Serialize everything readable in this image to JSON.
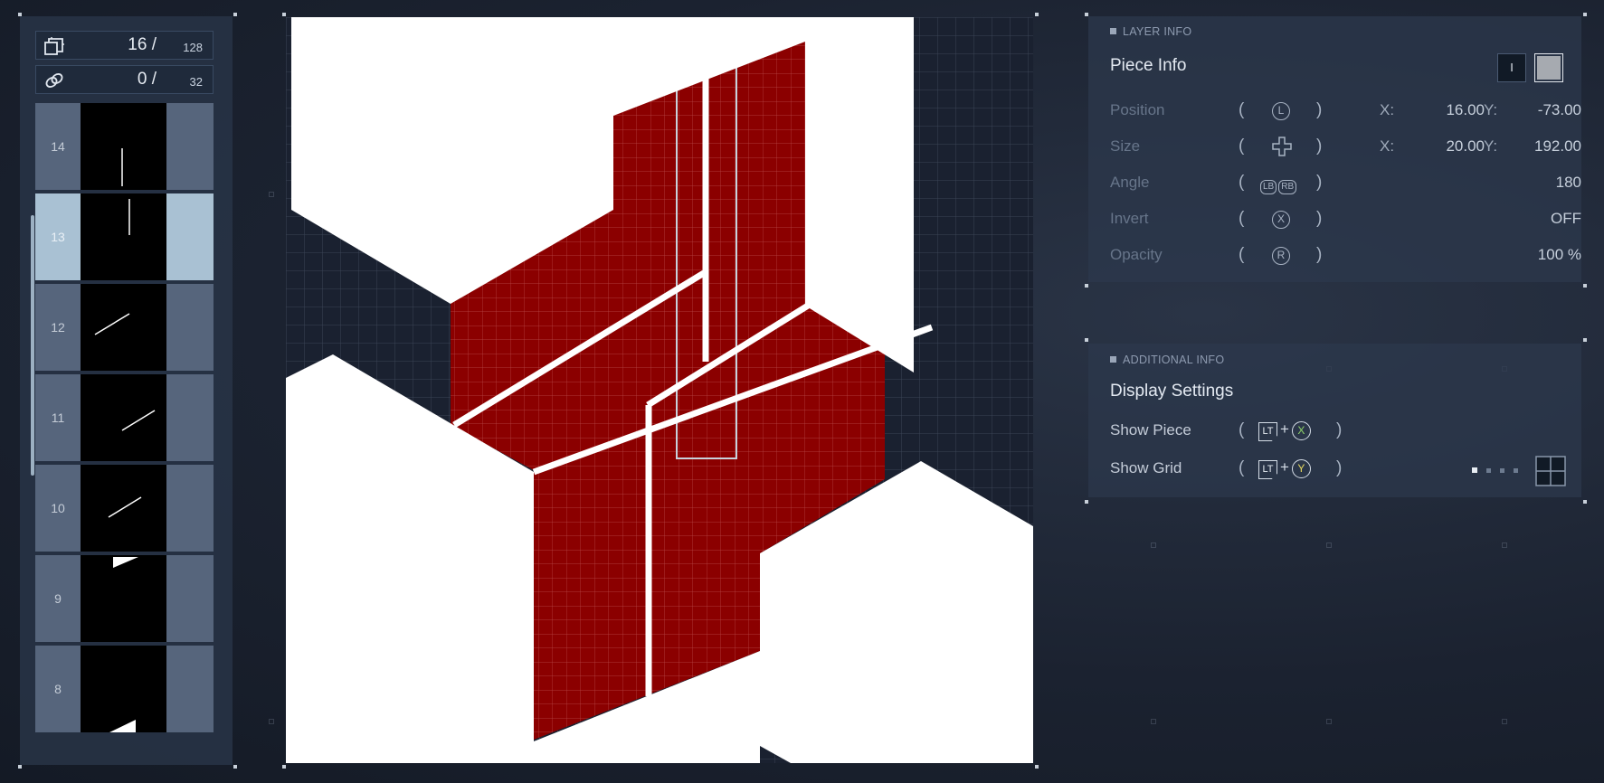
{
  "layers_panel": {
    "pieces_count": "16 /",
    "pieces_max": "128",
    "links_count": "0 /",
    "links_max": "32",
    "layers": [
      {
        "number": "14",
        "selected": false
      },
      {
        "number": "13",
        "selected": true
      },
      {
        "number": "12",
        "selected": false
      },
      {
        "number": "11",
        "selected": false
      },
      {
        "number": "10",
        "selected": false
      },
      {
        "number": "9",
        "selected": false
      },
      {
        "number": "8",
        "selected": false
      }
    ]
  },
  "canvas": {
    "piece_color": "#8b0000",
    "grid_color": "#3b4556",
    "background_color": "#1a2130"
  },
  "layer_info": {
    "section_label": "LAYER INFO",
    "title": "Piece Info",
    "toggle_label": "I",
    "color_swatch": "#a6aab0",
    "position": {
      "label": "Position",
      "button_icon": "L",
      "x_label": "X:",
      "x": "16.00",
      "y_label": "Y:",
      "y": "-73.00"
    },
    "size": {
      "label": "Size",
      "button_icon": "dpad-icon",
      "x_label": "X:",
      "x": "20.00",
      "y_label": "Y:",
      "y": "192.00"
    },
    "angle": {
      "label": "Angle",
      "buttons": [
        "LB",
        "RB"
      ],
      "value": "180"
    },
    "invert": {
      "label": "Invert",
      "button_icon": "X",
      "value": "OFF"
    },
    "opacity": {
      "label": "Opacity",
      "button_icon": "R",
      "value": "100 %"
    }
  },
  "additional_info": {
    "section_label": "ADDITIONAL INFO",
    "title": "Display Settings",
    "show_piece": {
      "label": "Show Piece",
      "trigger": "LT",
      "plus": "+",
      "button": "X",
      "button_color": "#8fd46a"
    },
    "show_grid": {
      "label": "Show Grid",
      "trigger": "LT",
      "plus": "+",
      "button": "Y",
      "button_color": "#e5d860",
      "active_level": 1,
      "levels": 4
    }
  }
}
